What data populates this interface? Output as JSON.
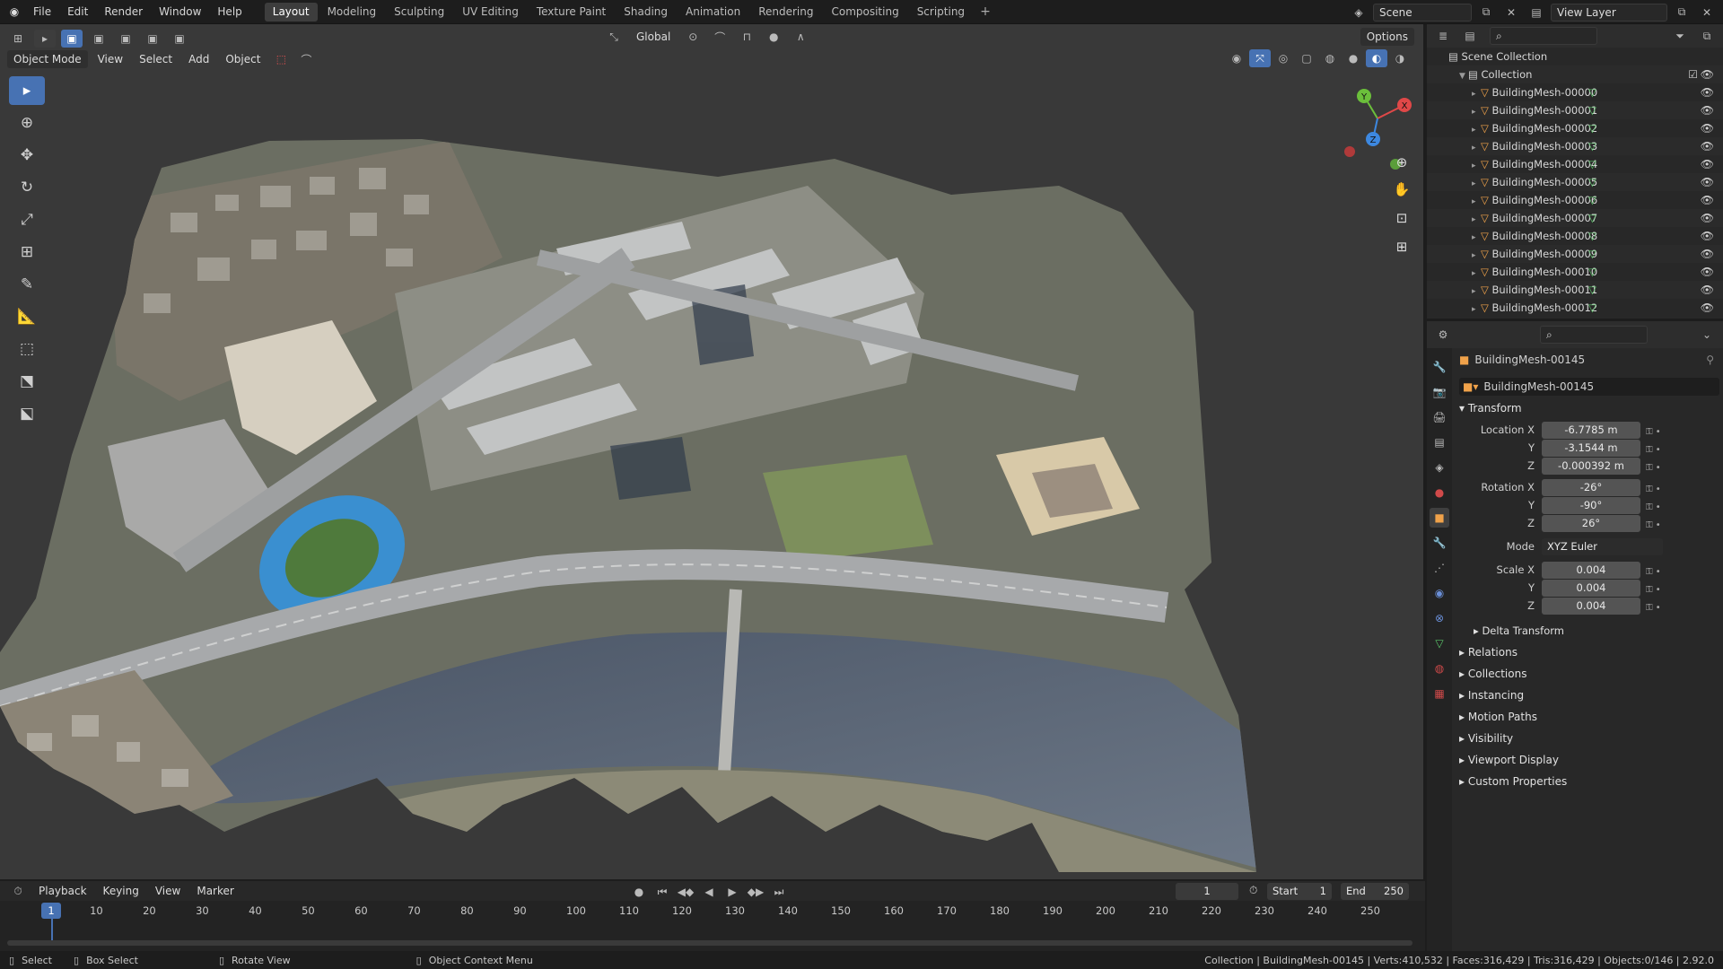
{
  "menus": [
    "File",
    "Edit",
    "Render",
    "Window",
    "Help"
  ],
  "workspaces": [
    "Layout",
    "Modeling",
    "Sculpting",
    "UV Editing",
    "Texture Paint",
    "Shading",
    "Animation",
    "Rendering",
    "Compositing",
    "Scripting"
  ],
  "active_workspace": "Layout",
  "scene": {
    "scene_name": "Scene",
    "view_layer": "View Layer"
  },
  "viewport": {
    "mode": "Object Mode",
    "menus": [
      "View",
      "Select",
      "Add",
      "Object"
    ],
    "transform_orientation": "Global",
    "options_label": "Options",
    "gizmo": {
      "x": "X",
      "y": "Y",
      "z": "Z"
    }
  },
  "outliner": {
    "scene_collection": "Scene Collection",
    "collection": "Collection",
    "items": [
      "BuildingMesh-00000",
      "BuildingMesh-00001",
      "BuildingMesh-00002",
      "BuildingMesh-00003",
      "BuildingMesh-00004",
      "BuildingMesh-00005",
      "BuildingMesh-00006",
      "BuildingMesh-00007",
      "BuildingMesh-00008",
      "BuildingMesh-00009",
      "BuildingMesh-00010",
      "BuildingMesh-00011",
      "BuildingMesh-00012"
    ]
  },
  "properties": {
    "object_name": "BuildingMesh-00145",
    "datablock_name": "BuildingMesh-00145",
    "transform_title": "Transform",
    "location": {
      "label": "Location X",
      "x": "-6.7785 m",
      "y": "-3.1544 m",
      "z": "-0.000392 m"
    },
    "rotation": {
      "label": "Rotation X",
      "x": "-26°",
      "y": "-90°",
      "z": "26°"
    },
    "mode": {
      "label": "Mode",
      "value": "XYZ Euler"
    },
    "scale": {
      "label": "Scale X",
      "x": "0.004",
      "y": "0.004",
      "z": "0.004"
    },
    "axis_y": "Y",
    "axis_z": "Z",
    "delta_transform": "Delta Transform",
    "panels": [
      "Relations",
      "Collections",
      "Instancing",
      "Motion Paths",
      "Visibility",
      "Viewport Display",
      "Custom Properties"
    ]
  },
  "timeline": {
    "menus": [
      "Playback",
      "Keying",
      "View",
      "Marker"
    ],
    "current_frame": "1",
    "start_label": "Start",
    "start": "1",
    "end_label": "End",
    "end": "250",
    "ticks": [
      "1",
      "10",
      "20",
      "30",
      "40",
      "50",
      "60",
      "70",
      "80",
      "90",
      "100",
      "110",
      "120",
      "130",
      "140",
      "150",
      "160",
      "170",
      "180",
      "190",
      "200",
      "210",
      "220",
      "230",
      "240",
      "250"
    ]
  },
  "statusbar": {
    "select": "Select",
    "box_select": "Box Select",
    "rotate_view": "Rotate View",
    "context_menu": "Object Context Menu",
    "info": "Collection | BuildingMesh-00145 | Verts:410,532 | Faces:316,429 | Tris:316,429 | Objects:0/146 | 2.92.0"
  },
  "colors": {
    "accent": "#4772b3",
    "object_orange": "#f0a24a",
    "mesh_green": "#5bc56a"
  }
}
